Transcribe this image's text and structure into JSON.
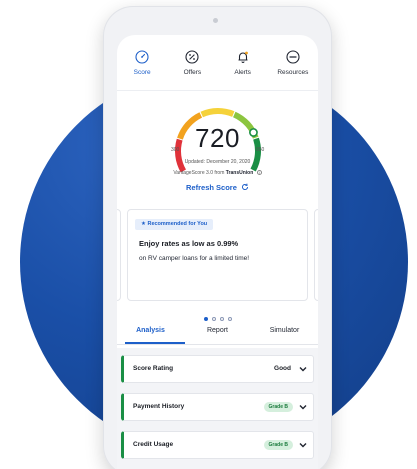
{
  "nav": {
    "items": [
      {
        "label": "Score",
        "icon": "speedometer-icon",
        "active": true
      },
      {
        "label": "Offers",
        "icon": "percent-icon",
        "active": false
      },
      {
        "label": "Alerts",
        "icon": "bell-icon",
        "active": false
      },
      {
        "label": "Resources",
        "icon": "ellipsis-icon",
        "active": false
      }
    ]
  },
  "score": {
    "value": "720",
    "min": "300",
    "max": "850",
    "updated": "Updated: December 20, 2020",
    "model_prefix": "VantageScore 3.0 from",
    "bureau": "TransUnion",
    "refresh_label": "Refresh Score",
    "gauge_level": 0.76,
    "gauge_colors": [
      "#e0323a",
      "#f2a21e",
      "#f5d23a",
      "#8cc53f",
      "#1a8f45"
    ]
  },
  "promo": {
    "badge": "Recommended for You",
    "title": "Enjoy rates as low as 0.99%",
    "subtitle": "on RV camper loans for a limited time!",
    "page_count": 4,
    "active_page": 0
  },
  "tabs": [
    {
      "label": "Analysis",
      "active": true
    },
    {
      "label": "Report",
      "active": false
    },
    {
      "label": "Simulator",
      "active": false
    }
  ],
  "factors": [
    {
      "label": "Score Rating",
      "value": "Good",
      "grade": ""
    },
    {
      "label": "Payment History",
      "value": "",
      "grade": "Grade B"
    },
    {
      "label": "Credit Usage",
      "value": "",
      "grade": "Grade B"
    }
  ],
  "colors": {
    "accent": "#1d5fc9",
    "background_circle": "#1a4fa7",
    "success": "#1a8f45"
  }
}
